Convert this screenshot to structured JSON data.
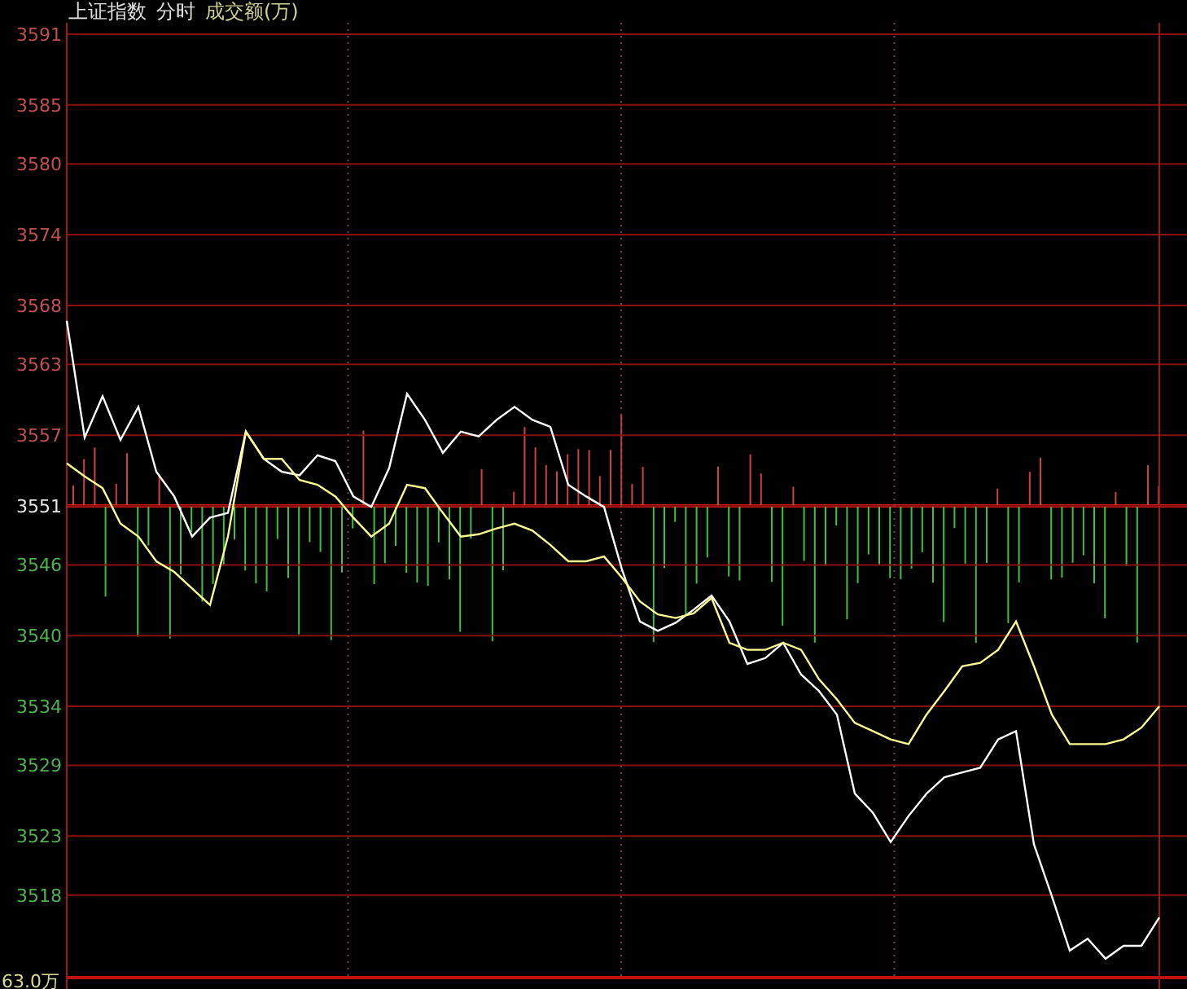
{
  "header": {
    "title": "上证指数",
    "mode": "分时",
    "volume_label": "成交额(万)"
  },
  "chart": {
    "chart_data": {
      "type": "line",
      "ylim": [
        3511,
        3591
      ],
      "yticks": [
        3591,
        3585,
        3580,
        3574,
        3568,
        3563,
        3557,
        3551,
        3546,
        3540,
        3534,
        3529,
        3523,
        3518
      ],
      "grid": true,
      "series": [
        {
          "color": "#ffffff",
          "values": [
            3566.7,
            3556.8,
            3560.3,
            3556.6,
            3559.4,
            3553.9,
            3551.8,
            3548.4,
            3550.0,
            3550.4,
            3557.3,
            3555.0,
            3553.9,
            3553.6,
            3555.3,
            3554.8,
            3551.8,
            3550.9,
            3554.2,
            3560.5,
            3558.3,
            3555.5,
            3557.3,
            3556.9,
            3558.3,
            3559.4,
            3558.3,
            3557.7,
            3552.8,
            3551.8,
            3550.9,
            3545.6,
            3541.2,
            3540.4,
            3541.1,
            3542.2,
            3543.4,
            3541.2,
            3537.6,
            3538.1,
            3539.4,
            3536.7,
            3535.3,
            3533.3,
            3526.6,
            3525.0,
            3522.5,
            3524.7,
            3526.6,
            3528.0,
            3528.4,
            3528.8,
            3531.2,
            3531.9,
            3522.3,
            3517.9,
            3513.3,
            3514.3,
            3512.6,
            3513.7,
            3513.7,
            3516.1
          ]
        },
        {
          "color": "#ffff90",
          "values": [
            3554.6,
            3553.5,
            3552.5,
            3549.5,
            3548.4,
            3546.3,
            3545.4,
            3544.0,
            3542.6,
            3548.4,
            3557.3,
            3555.0,
            3555.0,
            3553.2,
            3552.8,
            3551.8,
            3550.0,
            3548.4,
            3549.5,
            3552.8,
            3552.5,
            3550.4,
            3548.4,
            3548.6,
            3549.1,
            3549.5,
            3548.9,
            3547.7,
            3546.3,
            3546.3,
            3546.7,
            3544.9,
            3542.9,
            3541.8,
            3541.5,
            3541.9,
            3543.2,
            3539.4,
            3538.8,
            3538.8,
            3539.4,
            3538.8,
            3536.3,
            3534.6,
            3532.6,
            3531.9,
            3531.2,
            3530.8,
            3533.3,
            3535.3,
            3537.4,
            3537.7,
            3538.8,
            3541.2,
            3537.4,
            3533.3,
            3530.8,
            3530.8,
            3530.8,
            3531.2,
            3532.2,
            3534.0
          ]
        }
      ]
    },
    "volume_axis_label": "63.0万"
  }
}
